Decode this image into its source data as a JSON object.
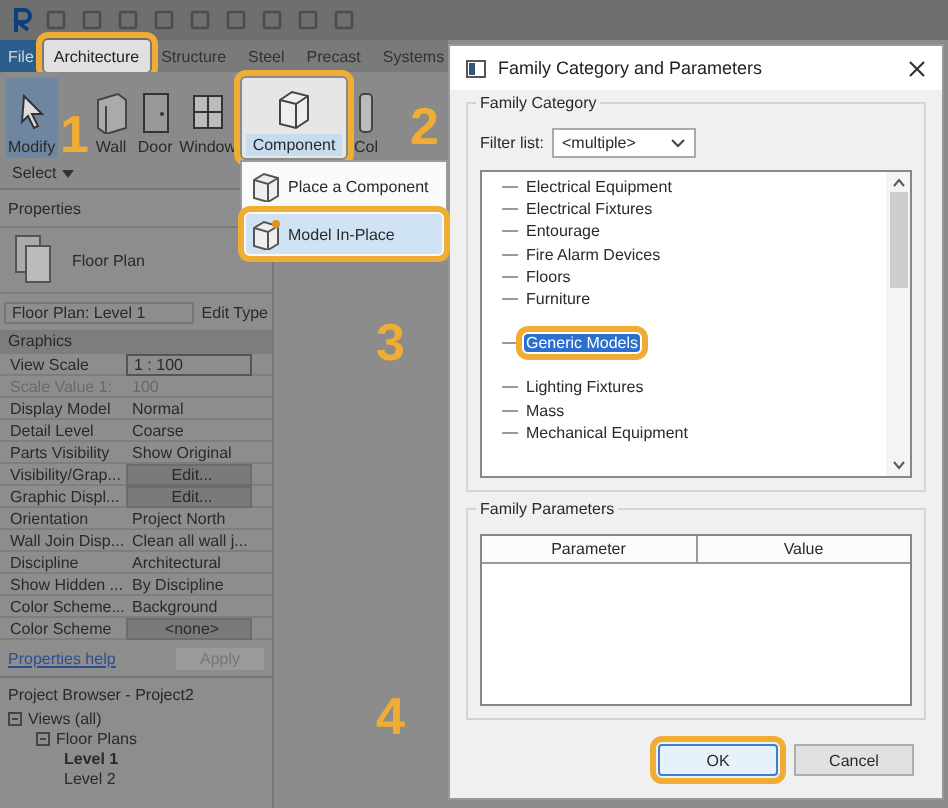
{
  "tabs": [
    {
      "label": "File",
      "selected": false,
      "highlighted": false
    },
    {
      "label": "Architecture",
      "selected": true,
      "highlighted": true
    },
    {
      "label": "Structure",
      "selected": false,
      "highlighted": false
    },
    {
      "label": "Steel",
      "selected": false,
      "highlighted": false
    },
    {
      "label": "Precast",
      "selected": false,
      "highlighted": false
    },
    {
      "label": "Systems",
      "selected": false,
      "highlighted": false
    }
  ],
  "ribbon": {
    "tools": [
      {
        "label": "Modify",
        "kind": "arrow",
        "selected": true,
        "highlighted": false
      },
      {
        "label": "Wall",
        "kind": "wall",
        "selected": false,
        "highlighted": false
      },
      {
        "label": "Door",
        "kind": "door",
        "selected": false,
        "highlighted": false
      },
      {
        "label": "Window",
        "kind": "window",
        "selected": false,
        "highlighted": false
      },
      {
        "label": "Component",
        "kind": "component",
        "selected": false,
        "highlighted": true
      },
      {
        "label": "Col",
        "kind": "column",
        "selected": false,
        "highlighted": false
      }
    ],
    "panel_label": "Select"
  },
  "component_menu": [
    {
      "label": "Place a Component",
      "highlighted": false
    },
    {
      "label": "Model In-Place",
      "highlighted": true
    }
  ],
  "properties": {
    "title": "Properties",
    "type_name": "Floor Plan",
    "instance": "Floor Plan: Level 1",
    "edit_type": "Edit Type",
    "group": "Graphics",
    "rows": [
      {
        "name": "View Scale",
        "value": "1 : 100",
        "kind": "field"
      },
      {
        "name": "Scale Value    1:",
        "value": "100",
        "kind": "disabled"
      },
      {
        "name": "Display Model",
        "value": "Normal",
        "kind": "text"
      },
      {
        "name": "Detail Level",
        "value": "Coarse",
        "kind": "text"
      },
      {
        "name": "Parts Visibility",
        "value": "Show Original",
        "kind": "text"
      },
      {
        "name": "Visibility/Grap...",
        "value": "Edit...",
        "kind": "button"
      },
      {
        "name": "Graphic Displ...",
        "value": "Edit...",
        "kind": "button"
      },
      {
        "name": "Orientation",
        "value": "Project North",
        "kind": "text"
      },
      {
        "name": "Wall Join Disp...",
        "value": "Clean all wall j...",
        "kind": "text"
      },
      {
        "name": "Discipline",
        "value": "Architectural",
        "kind": "text"
      },
      {
        "name": "Show Hidden ...",
        "value": "By Discipline",
        "kind": "text"
      },
      {
        "name": "Color Scheme...",
        "value": "Background",
        "kind": "text"
      },
      {
        "name": "Color Scheme",
        "value": "<none>",
        "kind": "button"
      }
    ],
    "help": "Properties help",
    "apply": "Apply"
  },
  "project_browser": {
    "title": "Project Browser - Project2",
    "tree": [
      {
        "label": "Views (all)",
        "expanded": true,
        "children": [
          {
            "label": "Floor Plans",
            "expanded": true,
            "children": [
              {
                "label": "Level 1",
                "selected": true
              },
              {
                "label": "Level 2",
                "selected": false
              }
            ]
          }
        ]
      }
    ]
  },
  "dialog": {
    "title": "Family Category and Parameters",
    "category_group": "Family Category",
    "filter_label": "Filter list:",
    "filter_value": "<multiple>",
    "categories": [
      {
        "label": "Electrical Equipment",
        "selected": false,
        "highlighted": false
      },
      {
        "label": "Electrical Fixtures",
        "selected": false,
        "highlighted": false
      },
      {
        "label": "Entourage",
        "selected": false,
        "highlighted": false
      },
      {
        "label": "Fire Alarm Devices",
        "selected": false,
        "highlighted": false
      },
      {
        "label": "Floors",
        "selected": false,
        "highlighted": false
      },
      {
        "label": "Furniture",
        "selected": false,
        "highlighted": false
      },
      {
        "label": "Generic Models",
        "selected": true,
        "highlighted": true
      },
      {
        "label": "Lighting Fixtures",
        "selected": false,
        "highlighted": false
      },
      {
        "label": "Mass",
        "selected": false,
        "highlighted": false
      },
      {
        "label": "Mechanical Equipment",
        "selected": false,
        "highlighted": false
      }
    ],
    "parameters_group": "Family Parameters",
    "columns": [
      "Parameter",
      "Value"
    ],
    "buttons": [
      {
        "label": "OK",
        "highlighted": true
      },
      {
        "label": "Cancel",
        "highlighted": false
      }
    ]
  },
  "annotations": [
    "1",
    "2",
    "3",
    "4"
  ]
}
